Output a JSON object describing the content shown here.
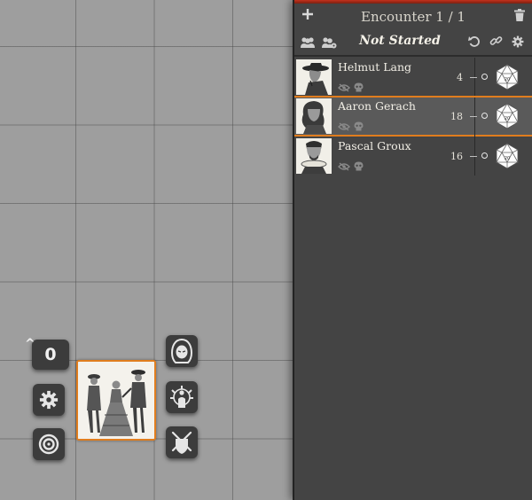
{
  "tracker": {
    "title": "Encounter 1 / 1",
    "status": "Not Started",
    "icons": {
      "add": "plus-icon",
      "delete": "trash-icon",
      "roll_all": "roll-all-icon",
      "roll_npc": "roll-npc-icon",
      "reset": "reset-icon",
      "link": "link-icon",
      "settings": "gear-icon"
    }
  },
  "combatants": [
    {
      "name": "Helmut Lang",
      "initiative": "4",
      "active": false
    },
    {
      "name": "Aaron Gerach",
      "initiative": "18",
      "active": true
    },
    {
      "name": "Pascal Groux",
      "initiative": "16",
      "active": false
    }
  ],
  "token_hud": {
    "elevation": "0",
    "left": [
      "elevation-control",
      "gear-icon",
      "target-icon"
    ],
    "right": [
      "hooded-figure-icon",
      "effects-icon",
      "combat-icon"
    ]
  },
  "colors": {
    "canvas": "#9e9e9e",
    "panel": "#444444",
    "accent_orange": "#e07d1e",
    "top_bar_red": "#c2311c"
  }
}
